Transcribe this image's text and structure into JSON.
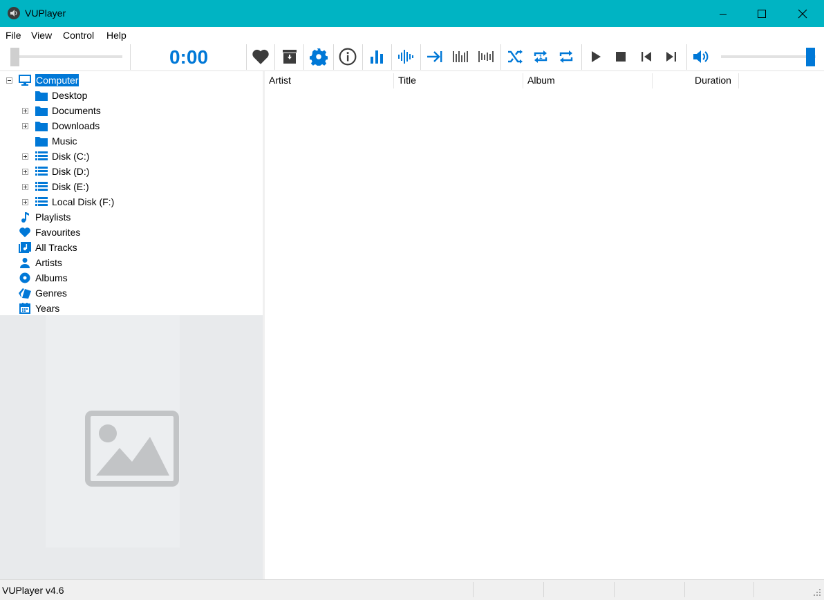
{
  "window": {
    "title": "VUPlayer",
    "minimize_icon": "minimize-icon",
    "maximize_icon": "maximize-icon",
    "close_icon": "close-icon"
  },
  "menu": [
    "File",
    "View",
    "Control",
    "Help"
  ],
  "toolbar": {
    "time": "0:00",
    "seek_position": 0.0,
    "volume_level": 1.0,
    "accent_color": "#0078d7",
    "icons": [
      "heart-icon",
      "archive-icon",
      "gear-icon",
      "info-icon",
      "bar-chart-icon",
      "waveform-icon",
      "skip-to-end-icon",
      "vu-meter-icon",
      "vu-meter-alt-icon",
      "shuffle-icon",
      "repeat-one-icon",
      "repeat-all-icon",
      "play-icon",
      "stop-icon",
      "previous-icon",
      "next-icon",
      "volume-icon"
    ]
  },
  "tree": {
    "items": [
      {
        "label": "Computer",
        "icon": "monitor-icon",
        "selected": true,
        "expander": "minus"
      },
      {
        "label": "Desktop",
        "icon": "folder-icon"
      },
      {
        "label": "Documents",
        "icon": "folder-icon",
        "expander": "plus"
      },
      {
        "label": "Downloads",
        "icon": "folder-icon",
        "expander": "plus"
      },
      {
        "label": "Music",
        "icon": "folder-icon"
      },
      {
        "label": "Disk (C:)",
        "icon": "drive-icon",
        "expander": "plus"
      },
      {
        "label": "Disk (D:)",
        "icon": "drive-icon",
        "expander": "plus"
      },
      {
        "label": "Disk (E:)",
        "icon": "drive-icon",
        "expander": "plus"
      },
      {
        "label": "Local Disk (F:)",
        "icon": "drive-icon",
        "expander": "plus"
      },
      {
        "label": "Playlists",
        "icon": "music-note-icon"
      },
      {
        "label": "Favourites",
        "icon": "heart-icon"
      },
      {
        "label": "All Tracks",
        "icon": "tracks-icon"
      },
      {
        "label": "Artists",
        "icon": "person-icon"
      },
      {
        "label": "Albums",
        "icon": "disc-icon"
      },
      {
        "label": "Genres",
        "icon": "genres-icon"
      },
      {
        "label": "Years",
        "icon": "calendar-icon"
      }
    ]
  },
  "artwork": {
    "icon": "image-placeholder-icon"
  },
  "playlist": {
    "columns": [
      "Artist",
      "Title",
      "Album",
      "Duration"
    ],
    "rows": []
  },
  "status": {
    "text": "VUPlayer v4.6"
  }
}
